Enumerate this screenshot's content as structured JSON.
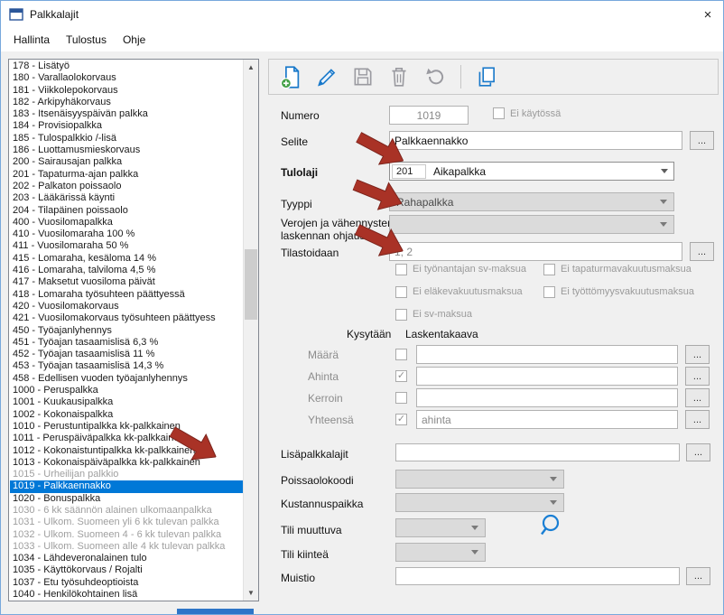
{
  "window": {
    "title": "Palkkalajit",
    "close_glyph": "×"
  },
  "menu": {
    "items": [
      {
        "label": "Hallinta"
      },
      {
        "label": "Tulostus"
      },
      {
        "label": "Ohje"
      }
    ]
  },
  "toolbar": {
    "buttons": [
      {
        "name": "new-icon",
        "enabled": true
      },
      {
        "name": "edit-icon",
        "enabled": true
      },
      {
        "name": "save-icon",
        "enabled": false
      },
      {
        "name": "delete-icon",
        "enabled": false
      },
      {
        "name": "undo-icon",
        "enabled": false
      },
      {
        "name": "copy-icon",
        "enabled": true
      }
    ]
  },
  "list": {
    "selected": "1019 - Palkkaennakko",
    "items": [
      {
        "label": "178 - Lisätyö",
        "state": "normal"
      },
      {
        "label": "180 - Varallaolokorvaus",
        "state": "normal"
      },
      {
        "label": "181 - Viikkolepokorvaus",
        "state": "normal"
      },
      {
        "label": "182 - Arkipyhäkorvaus",
        "state": "normal"
      },
      {
        "label": "183 - Itsenäisyyspäivän palkka",
        "state": "normal"
      },
      {
        "label": "184 - Provisiopalkka",
        "state": "normal"
      },
      {
        "label": "185 - Tulospalkkio /-lisä",
        "state": "normal"
      },
      {
        "label": "186 - Luottamusmieskorvaus",
        "state": "normal"
      },
      {
        "label": "200 - Sairausajan palkka",
        "state": "normal"
      },
      {
        "label": "201 - Tapaturma-ajan palkka",
        "state": "normal"
      },
      {
        "label": "202 - Palkaton poissaolo",
        "state": "normal"
      },
      {
        "label": "203 - Lääkärissä käynti",
        "state": "normal"
      },
      {
        "label": "204 - Tilapäinen poissaolo",
        "state": "normal"
      },
      {
        "label": "400 - Vuosilomapalkka",
        "state": "normal"
      },
      {
        "label": "410 - Vuosilomaraha 100 %",
        "state": "normal"
      },
      {
        "label": "411 - Vuosilomaraha 50 %",
        "state": "normal"
      },
      {
        "label": "415 - Lomaraha, kesäloma 14 %",
        "state": "normal"
      },
      {
        "label": "416 - Lomaraha, talviloma 4,5 %",
        "state": "normal"
      },
      {
        "label": "417 - Maksetut vuosiloma päivät",
        "state": "normal"
      },
      {
        "label": "418 - Lomaraha työsuhteen päättyessä",
        "state": "normal"
      },
      {
        "label": "420 - Vuosilomakorvaus",
        "state": "normal"
      },
      {
        "label": "421 - Vuosilomakorvaus työsuhteen päättyess",
        "state": "normal"
      },
      {
        "label": "450 - Työajanlyhennys",
        "state": "normal"
      },
      {
        "label": "451 - Työajan tasaamislisä 6,3 %",
        "state": "normal"
      },
      {
        "label": "452 - Työajan tasaamislisä 11 %",
        "state": "normal"
      },
      {
        "label": "453 - Työajan tasaamislisä 14,3 %",
        "state": "normal"
      },
      {
        "label": "458 - Edellisen vuoden työajanlyhennys",
        "state": "normal"
      },
      {
        "label": "1000 - Peruspalkka",
        "state": "normal"
      },
      {
        "label": "1001 - Kuukausipalkka",
        "state": "normal"
      },
      {
        "label": "1002 - Kokonaispalkka",
        "state": "normal"
      },
      {
        "label": "1010 - Perustuntipalkka kk-palkkainen",
        "state": "normal"
      },
      {
        "label": "1011 - Peruspäiväpalkka kk-palkkainen",
        "state": "normal"
      },
      {
        "label": "1012 - Kokonaistuntipalkka kk-palkkainen",
        "state": "normal"
      },
      {
        "label": "1013 - Kokonaispäiväpalkka kk-palkkainen",
        "state": "normal"
      },
      {
        "label": "1015 - Urheilijan palkkio",
        "state": "disabled"
      },
      {
        "label": "1019 - Palkkaennakko",
        "state": "selected"
      },
      {
        "label": "1020 - Bonuspalkka",
        "state": "normal"
      },
      {
        "label": "1030 - 6 kk säännön alainen ulkomaanpalkka",
        "state": "disabled"
      },
      {
        "label": "1031 - Ulkom. Suomeen yli 6 kk tulevan palkka",
        "state": "disabled"
      },
      {
        "label": "1032 - Ulkom. Suomeen 4 - 6 kk tulevan palkka",
        "state": "disabled"
      },
      {
        "label": "1033 - Ulkom. Suomeen alle 4 kk tulevan palkka",
        "state": "disabled"
      },
      {
        "label": "1034 - Lähdeveronalainen tulo",
        "state": "normal"
      },
      {
        "label": "1035 - Käyttökorvaus / Rojalti",
        "state": "normal"
      },
      {
        "label": "1037 - Etu työsuhdeoptioista",
        "state": "normal"
      },
      {
        "label": "1040 - Henkilökohtainen lisä",
        "state": "normal"
      }
    ]
  },
  "form": {
    "numero": {
      "label": "Numero",
      "value": "1019"
    },
    "ei_kaytossa": {
      "label": "Ei käytössä",
      "checked": false
    },
    "selite": {
      "label": "Selite",
      "value": "Palkkaennakko"
    },
    "tulolaji": {
      "label": "Tulolaji",
      "code": "201",
      "value": "Aikapalkka"
    },
    "tyyppi": {
      "label": "Tyyppi",
      "value": "Rahapalkka"
    },
    "verojen": {
      "label_line1": "Verojen ja vähennysten",
      "label_line2": "laskennan ohjaus",
      "value": ""
    },
    "tilastoidaan": {
      "label": "Tilastoidaan",
      "value": "1, 2"
    },
    "maksu_checkboxes": [
      {
        "label": "Ei työnantajan sv-maksua",
        "checked": false
      },
      {
        "label": "Ei tapaturmavakuutusmaksua",
        "checked": false
      },
      {
        "label": "Ei eläkevakuutusmaksua",
        "checked": false
      },
      {
        "label": "Ei työttömyysvakuutusmaksua",
        "checked": false
      },
      {
        "label": "Ei sv-maksua",
        "checked": false
      }
    ],
    "kysytaan_header": "Kysytään",
    "laskentakaava_header": "Laskentakaava",
    "formula_rows": [
      {
        "label": "Määrä",
        "checked": false,
        "value": ""
      },
      {
        "label": "Ahinta",
        "checked": true,
        "value": ""
      },
      {
        "label": "Kerroin",
        "checked": false,
        "value": ""
      },
      {
        "label": "Yhteensä",
        "checked": true,
        "value": "ahinta"
      }
    ],
    "lisapalkkalajit": {
      "label": "Lisäpalkkalajit",
      "value": ""
    },
    "poissaolokoodi": {
      "label": "Poissaolokoodi",
      "value": ""
    },
    "kustannuspaikka": {
      "label": "Kustannuspaikka",
      "value": ""
    },
    "tili_muuttuva": {
      "label": "Tili muuttuva",
      "value": ""
    },
    "tili_kiintea": {
      "label": "Tili kiinteä",
      "value": ""
    },
    "muistio": {
      "label": "Muistio",
      "value": ""
    },
    "dots_label": "..."
  },
  "colors": {
    "selection": "#0078d7",
    "accent_blue": "#1979ca",
    "annotation_arrow": "#a93226",
    "disabled_field": "#dbdbdb"
  }
}
